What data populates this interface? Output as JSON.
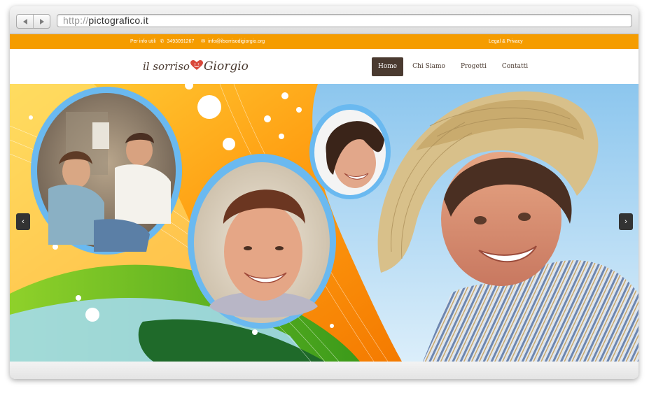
{
  "browser": {
    "url_scheme": "http://",
    "url_host": "pictografico.it"
  },
  "topbar": {
    "info_label": "Per info utili",
    "phone": "3493091267",
    "email": "info@ilsorrisodigiorgio.org",
    "legal": "Legal & Privacy"
  },
  "header": {
    "logo_part1": "il sorriso",
    "logo_part2": "Giorgio",
    "menu": [
      {
        "label": "Home"
      },
      {
        "label": "Chi Siamo"
      },
      {
        "label": "Progetti"
      },
      {
        "label": "Contatti"
      }
    ]
  },
  "slider": {
    "prev_glyph": "‹",
    "next_glyph": "›"
  },
  "colors": {
    "topbar": "#f59c00",
    "menu_active": "#4a3a30",
    "frame_blue": "#6ab9f0"
  }
}
